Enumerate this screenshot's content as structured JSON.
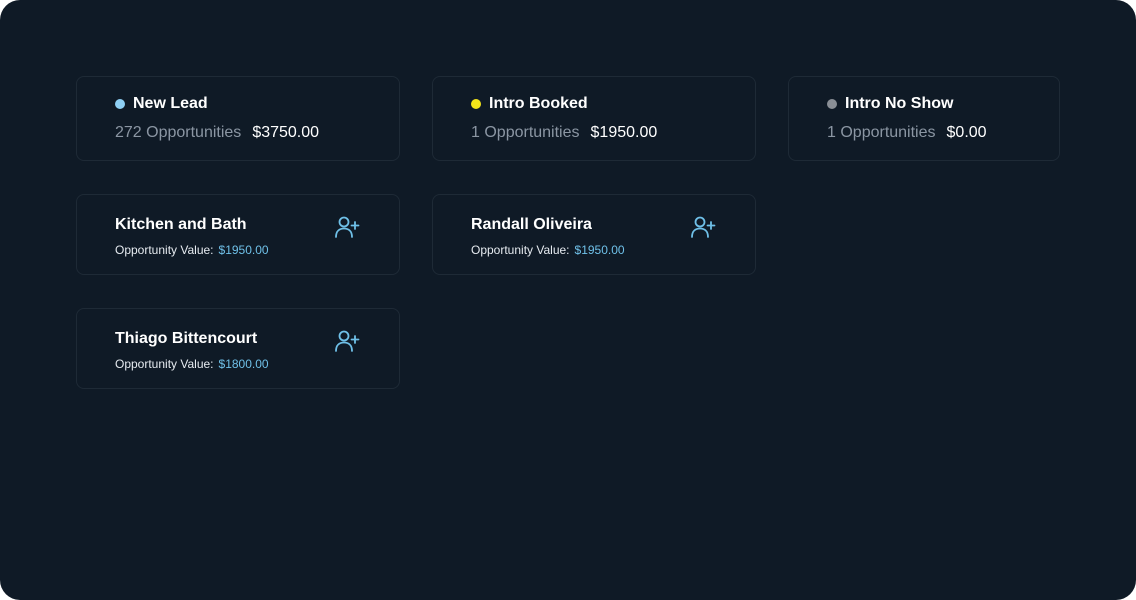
{
  "stages": [
    {
      "name": "New Lead",
      "dot_color": "#8fd0f5",
      "count_text": "272 Opportunities",
      "amount": "$3750.00"
    },
    {
      "name": "Intro Booked",
      "dot_color": "#f5e61a",
      "count_text": "1 Opportunities",
      "amount": "$1950.00"
    },
    {
      "name": "Intro No Show",
      "dot_color": "#8a8f96",
      "count_text": "1 Opportunities",
      "amount": "$0.00"
    }
  ],
  "opportunities": [
    {
      "name": "Kitchen and Bath",
      "value_label": "Opportunity Value:",
      "value": "$1950.00",
      "icon": "user-plus-icon"
    },
    {
      "name": "Randall Oliveira",
      "value_label": "Opportunity Value:",
      "value": "$1950.00",
      "icon": "user-plus-icon"
    },
    {
      "name": "Thiago Bittencourt",
      "value_label": "Opportunity Value:",
      "value": "$1800.00",
      "icon": "user-plus-icon"
    }
  ],
  "colors": {
    "background": "#0f1a26",
    "card_border": "#1e2a36",
    "accent": "#6fc0e8"
  }
}
